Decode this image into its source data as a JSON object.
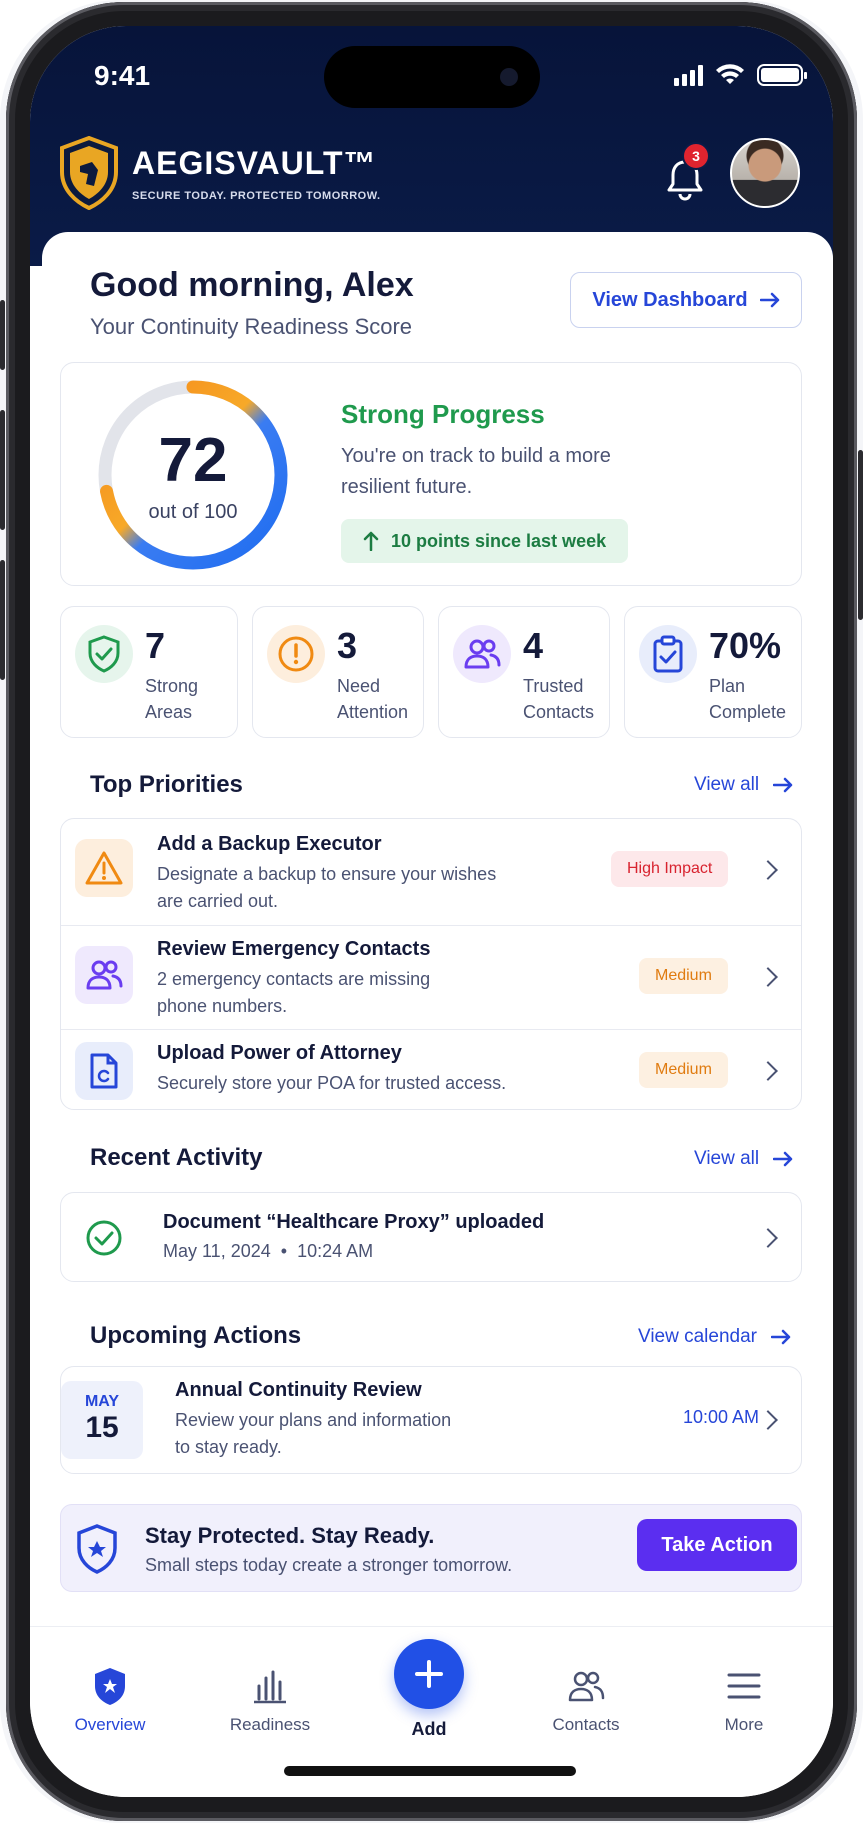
{
  "status_bar": {
    "time": "9:41"
  },
  "brand": {
    "name": "AEGISVAULT™",
    "tagline": "SECURE TODAY. PROTECTED TOMORROW."
  },
  "notifications": {
    "count": "3"
  },
  "greeting": {
    "title": "Good morning, Alex",
    "subtitle": "Your Continuity Readiness Score",
    "dashboard_button": "View Dashboard"
  },
  "score": {
    "value": "72",
    "out_of": "out of 100",
    "fraction": 0.72,
    "status": "Strong Progress",
    "message": "You're on track to build a more resilient future.",
    "change": "10 points since last week"
  },
  "stats": [
    {
      "value": "7",
      "label_line1": "Strong",
      "label_line2": "Areas",
      "icon": "shield-check-icon",
      "color": "#1f9a4d"
    },
    {
      "value": "3",
      "label_line1": "Need",
      "label_line2": "Attention",
      "icon": "alert-circle-icon",
      "color": "#f08a12"
    },
    {
      "value": "4",
      "label_line1": "Trusted",
      "label_line2": "Contacts",
      "icon": "users-icon",
      "color": "#6a3df0"
    },
    {
      "value": "70%",
      "label_line1": "Plan",
      "label_line2": "Complete",
      "icon": "clipboard-check-icon",
      "color": "#2646d8"
    }
  ],
  "priorities": {
    "title": "Top Priorities",
    "view_all": "View all",
    "items": [
      {
        "title": "Add a Backup Executor",
        "desc_line1": "Designate a backup to ensure your wishes",
        "desc_line2": "are carried out.",
        "badge": "High Impact",
        "icon": "warning-triangle-icon"
      },
      {
        "title": "Review Emergency Contacts",
        "desc_line1": "2 emergency contacts are missing",
        "desc_line2": "phone numbers.",
        "badge": "Medium",
        "icon": "users-icon"
      },
      {
        "title": "Upload Power of Attorney",
        "desc_line1": "Securely store your POA for trusted access.",
        "desc_line2": "",
        "badge": "Medium",
        "icon": "document-icon"
      }
    ]
  },
  "activity": {
    "title": "Recent Activity",
    "view_all": "View all",
    "items": [
      {
        "title": "Document “Healthcare Proxy” uploaded",
        "date": "May 11, 2024",
        "time": "10:24 AM",
        "icon": "check-circle-icon"
      }
    ]
  },
  "upcoming": {
    "title": "Upcoming Actions",
    "view_calendar": "View calendar",
    "items": [
      {
        "month": "MAY",
        "day": "15",
        "title": "Annual Continuity Review",
        "desc_line1": "Review your plans and information",
        "desc_line2": "to stay ready.",
        "time": "10:00 AM"
      }
    ]
  },
  "cta": {
    "title": "Stay Protected. Stay Ready.",
    "subtitle": "Small steps today create a stronger tomorrow.",
    "button": "Take Action"
  },
  "tabs": [
    {
      "label": "Overview",
      "icon": "shield-icon",
      "active": true
    },
    {
      "label": "Readiness",
      "icon": "bar-chart-icon",
      "active": false
    },
    {
      "label": "Add",
      "icon": "plus-icon",
      "active": false
    },
    {
      "label": "Contacts",
      "icon": "users-icon",
      "active": false
    },
    {
      "label": "More",
      "icon": "menu-icon",
      "active": false
    }
  ],
  "colors": {
    "brand_navy": "#0a1b47",
    "accent_blue": "#2646d8",
    "success_green": "#1f9a4d",
    "warning_orange": "#f08a12",
    "danger_red": "#d8232f",
    "cta_purple": "#5b2ef0"
  }
}
